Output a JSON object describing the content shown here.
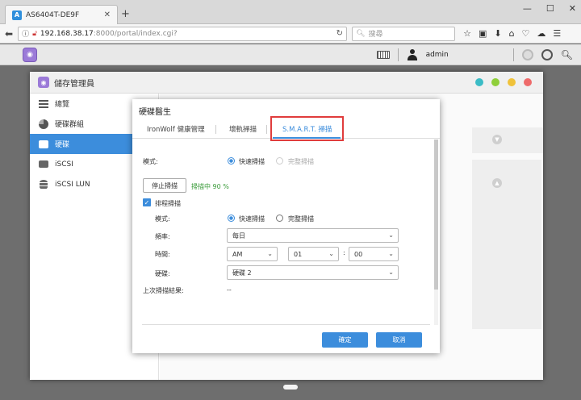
{
  "browser": {
    "tab_title": "AS6404T-DE9F",
    "new_tab": "+",
    "url_host": "192.168.38.17",
    "url_path": ":8000/portal/index.cgi?",
    "search_placeholder": "搜尋"
  },
  "adm_bar": {
    "user": "admin"
  },
  "window": {
    "title": "儲存管理員",
    "sidebar": [
      {
        "label": "總覽"
      },
      {
        "label": "硬碟群組"
      },
      {
        "label": "硬碟"
      },
      {
        "label": "iSCSI"
      },
      {
        "label": "iSCSI LUN"
      }
    ],
    "dot_colors": [
      "#3bbcc6",
      "#8fcf3a",
      "#f0c23a",
      "#ee6a6a"
    ]
  },
  "dialog": {
    "title": "硬碟醫生",
    "tabs": [
      "IronWolf 健康管理",
      "壞軌掃描",
      "S.M.A.R.T. 掃描"
    ],
    "mode_label": "模式:",
    "quick_scan": "快速掃描",
    "full_scan": "完整掃描",
    "stop_button": "停止掃描",
    "progress_text": "掃描中 90 %",
    "schedule_label": "排程掃描",
    "sched_mode_label": "模式:",
    "frequency_label": "頻率:",
    "frequency_value": "每日",
    "time_label": "時間:",
    "ampm_value": "AM",
    "hour_value": "01",
    "time_colon": ":",
    "minute_value": "00",
    "disk_label": "硬碟:",
    "disk_value": "硬碟 2",
    "last_result_label": "上次掃描結果:",
    "last_result_value": "--",
    "ok_button": "確定",
    "cancel_button": "取消"
  },
  "accent_color": "#3c8ddc",
  "highlight_color": "#e03c3c"
}
